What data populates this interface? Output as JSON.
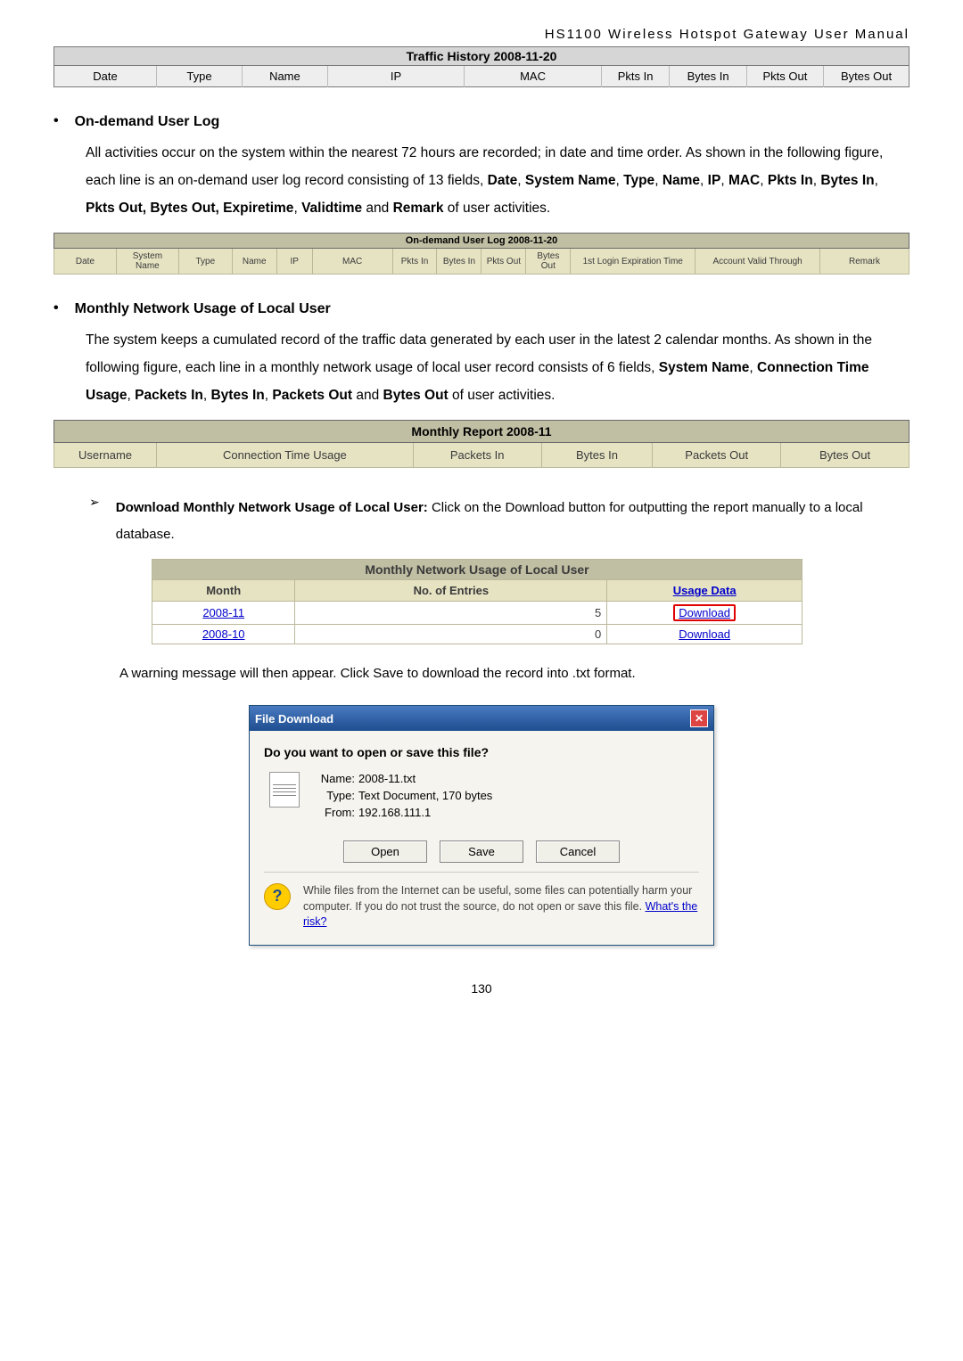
{
  "doc_header": "HS1100  Wireless  Hotspot  Gateway  User  Manual",
  "traffic_history": {
    "title": "Traffic History 2008-11-20",
    "cols": [
      "Date",
      "Type",
      "Name",
      "IP",
      "MAC",
      "Pkts In",
      "Bytes In",
      "Pkts Out",
      "Bytes Out"
    ]
  },
  "sec_ondemand": {
    "bullet": "•",
    "title": "On-demand User Log",
    "body_1": "All activities occur on the system within the nearest 72 hours are recorded; in date and time order. As shown in the following figure, each line is an on-demand user log record consisting of 13 fields, ",
    "bold1": "Date",
    "c1": ", ",
    "bold2": "System Name",
    "c2": ", ",
    "bold3": "Type",
    "c3": ", ",
    "bold4": "Name",
    "c4": ", ",
    "bold5": "IP",
    "c5": ", ",
    "bold6": "MAC",
    "c6": ", ",
    "bold7": "Pkts In",
    "c7": ", ",
    "bold8": "Bytes In",
    "c8": ", ",
    "bold9": "Pkts Out, Bytes Out, Expiretime",
    "c9": ", ",
    "bold10": "Validtime",
    "c10": " and ",
    "bold11": "Remark",
    "tail": " of user activities."
  },
  "ondemand_table": {
    "title": "On-demand User Log 2008-11-20",
    "cols": [
      "Date",
      "System Name",
      "Type",
      "Name",
      "IP",
      "MAC",
      "Pkts In",
      "Bytes In",
      "Pkts Out",
      "Bytes Out",
      "1st Login Expiration Time",
      "Account Valid Through",
      "Remark"
    ]
  },
  "sec_monthly": {
    "bullet": "•",
    "title": "Monthly Network Usage of Local User",
    "body_1": "The system keeps a cumulated record of the traffic data generated by each user in the latest 2 calendar months. As shown in the following figure, each line in a monthly network usage of local user record consists of 6 fields, ",
    "bold1": "System Name",
    "c1": ", ",
    "bold2": "Connection Time Usage",
    "c2": ", ",
    "bold3": "Packets In",
    "c3": ", ",
    "bold4": "Bytes In",
    "c4": ", ",
    "bold5": "Packets Out",
    "c5": " and ",
    "bold6": "Bytes Out",
    "tail": " of user activities."
  },
  "monthly_table": {
    "title": "Monthly Report 2008-11",
    "cols": [
      "Username",
      "Connection Time Usage",
      "Packets In",
      "Bytes In",
      "Packets Out",
      "Bytes Out"
    ]
  },
  "download_sec": {
    "chevron": "➢",
    "lead_bold": "Download Monthly Network Usage of Local User:",
    "lead_text": " Click on the Download  button for outputting the report manually to a local database.",
    "after_table_text": "A warning message will then appear. Click Save to download the record into .txt format."
  },
  "usage_table": {
    "title": "Monthly Network Usage of Local User",
    "cols": [
      "Month",
      "No. of Entries",
      "Usage Data"
    ],
    "rows": [
      {
        "month": "2008-11",
        "entries": "5",
        "link": "Download",
        "highlight": true
      },
      {
        "month": "2008-10",
        "entries": "0",
        "link": "Download",
        "highlight": false
      }
    ]
  },
  "dialog": {
    "title": "File Download",
    "question": "Do you want to open or save this file?",
    "labels": {
      "name": "Name:",
      "type": "Type:",
      "from": "From:"
    },
    "values": {
      "name": "2008-11.txt",
      "type": "Text Document, 170 bytes",
      "from": "192.168.111.1"
    },
    "buttons": {
      "open": "Open",
      "save": "Save",
      "cancel": "Cancel"
    },
    "warn_text": "While files from the Internet can be useful, some files can potentially harm your computer. If you do not trust the source, do not open or save this file. ",
    "warn_link": "What's the risk?"
  },
  "page_number": "130"
}
